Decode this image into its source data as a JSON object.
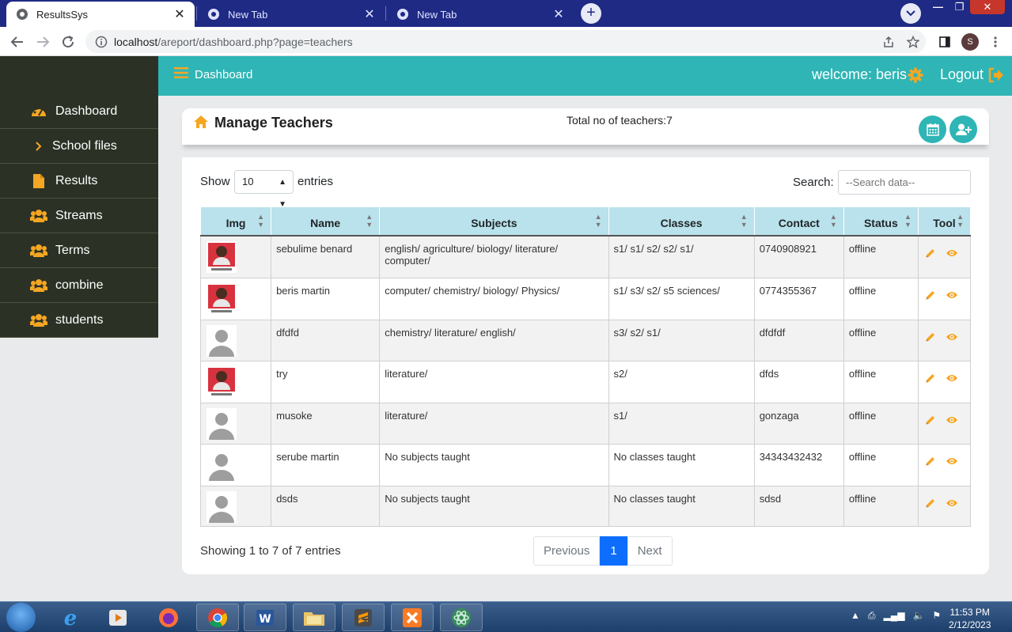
{
  "browser": {
    "tabs": [
      {
        "title": "ResultsSys",
        "active": true
      },
      {
        "title": "New Tab",
        "active": false
      },
      {
        "title": "New Tab",
        "active": false
      }
    ],
    "url_host": "localhost",
    "url_path": "/areport/dashboard.php?page=teachers",
    "profile_initial": "S"
  },
  "sidebar": {
    "items": [
      {
        "label": "Dashboard",
        "icon": "palette-icon"
      },
      {
        "label": "School files",
        "icon": "chevron-right-icon"
      },
      {
        "label": "Results",
        "icon": "file-icon"
      },
      {
        "label": "Streams",
        "icon": "users-icon"
      },
      {
        "label": "Terms",
        "icon": "users-icon"
      },
      {
        "label": "combine",
        "icon": "users-icon"
      },
      {
        "label": "students",
        "icon": "users-icon"
      }
    ]
  },
  "topbar": {
    "title": "Dashboard",
    "welcome": "welcome: beris",
    "logout": "Logout"
  },
  "header": {
    "title": "Manage Teachers",
    "total": "Total no of teachers:7"
  },
  "table_controls": {
    "show": "Show",
    "entries_value": "10",
    "entries": "entries",
    "search_label": "Search:",
    "search_placeholder": "--Search data--"
  },
  "table": {
    "columns": [
      "Img",
      "Name",
      "Subjects",
      "Classes",
      "Contact",
      "Status",
      "Tool"
    ],
    "rows": [
      {
        "avatar": "photo",
        "name": "sebulime benard",
        "subjects": "english/ agriculture/ biology/ literature/ computer/",
        "classes": "s1/ s1/ s2/ s2/ s1/",
        "contact": "0740908921",
        "status": "offline"
      },
      {
        "avatar": "photo",
        "name": "beris martin",
        "subjects": "computer/ chemistry/ biology/ Physics/",
        "classes": "s1/ s3/ s2/ s5 sciences/",
        "contact": "0774355367",
        "status": "offline"
      },
      {
        "avatar": "placeholder",
        "name": "dfdfd",
        "subjects": "chemistry/ literature/ english/",
        "classes": "s3/ s2/ s1/",
        "contact": "dfdfdf",
        "status": "offline"
      },
      {
        "avatar": "photo",
        "name": "try",
        "subjects": "literature/",
        "classes": "s2/",
        "contact": "dfds",
        "status": "offline"
      },
      {
        "avatar": "placeholder",
        "name": "musoke",
        "subjects": "literature/",
        "classes": "s1/",
        "contact": "gonzaga",
        "status": "offline"
      },
      {
        "avatar": "placeholder",
        "name": "serube martin",
        "subjects": "No subjects taught",
        "classes": "No classes taught",
        "contact": "34343432432",
        "status": "offline"
      },
      {
        "avatar": "placeholder",
        "name": "dsds",
        "subjects": "No subjects taught",
        "classes": "No classes taught",
        "contact": "sdsd",
        "status": "offline"
      }
    ]
  },
  "footer": {
    "showing": "Showing 1 to 7 of 7 entries",
    "previous": "Previous",
    "page": "1",
    "next": "Next"
  },
  "taskbar": {
    "time": "11:53 PM",
    "date": "2/12/2023"
  },
  "colors": {
    "accent": "#2fb5b5",
    "sidebar": "#2b3225",
    "orange": "#f5a623",
    "offline": "#dc3545",
    "header_row": "#b9e2ec",
    "page_active": "#0d6efd"
  }
}
